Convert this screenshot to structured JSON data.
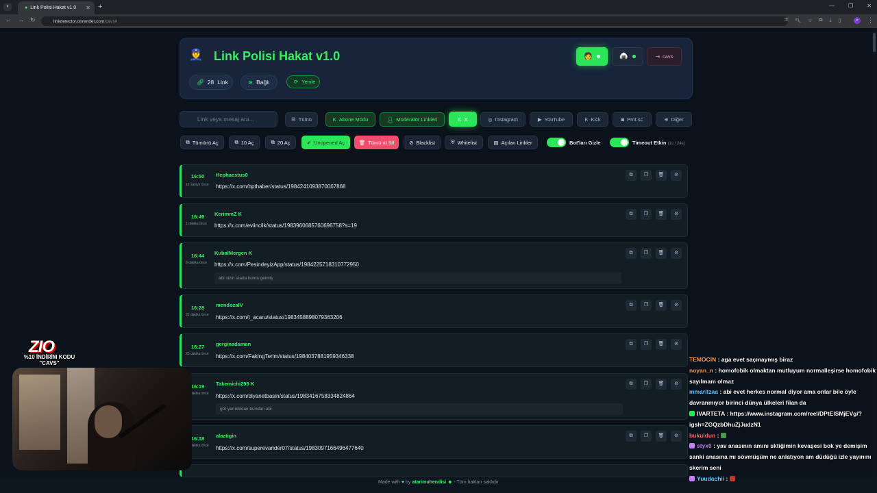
{
  "browser": {
    "tab_title": "Link Polisi Hakat v1.0",
    "tab_close": "✕",
    "new_tab": "+",
    "url_host": "linkdetector.onrender.com",
    "url_path": "/cavs#"
  },
  "header": {
    "title": "Link Polisi Hakat v1.0",
    "link_count": "28",
    "link_label": "Link",
    "connection_label": "Bağlı",
    "refresh_label": "Yenile",
    "logout_label": "cavs"
  },
  "filters": {
    "search_placeholder": "Link veya mesaj ara...",
    "all": "Tümü",
    "subscriber": "Abone Modu",
    "moderator": "Moderatör Linkleri",
    "x": "X",
    "instagram": "Instagram",
    "youtube": "YouTube",
    "kick": "Kick",
    "prnt": "Prnt.sc",
    "other": "Diğer"
  },
  "actions": {
    "open_all": "Tümünü Aç",
    "open_10": "10 Aç",
    "open_20": "20 Aç",
    "open_unopened": "Unopened Aç",
    "delete_all": "Tümünü Sil",
    "blacklist": "Blacklist",
    "whitelist": "Whitelist",
    "opened_links": "Açılan Linkler",
    "hide_bots": "Bot'ları Gizle",
    "timeout_active": "Timeout Etkin",
    "timeout_sub": "(1s / 24s)"
  },
  "links": [
    {
      "time": "16:50",
      "ago": "12 saniye önce",
      "user": "Hephaestus0",
      "url": "https://x.com/bpthaber/status/1984241093870067868",
      "msg": ""
    },
    {
      "time": "16:49",
      "ago": "1 dakika önce",
      "user": "KerimmZ",
      "url": "https://x.com/eviincilk/status/1983960685760696758?s=19",
      "msg": ""
    },
    {
      "time": "16:44",
      "ago": "6 dakika önce",
      "user": "KubalMergen",
      "url": "https://x.com/PesindeyizApp/status/1984225718310772950",
      "msg": "abi sizin stada kuma gelmiş"
    },
    {
      "time": "16:28",
      "ago": "22 dakika önce",
      "user": "mendozaIV",
      "url": "https://x.com/t_acaru/status/1983458898079363206",
      "msg": ""
    },
    {
      "time": "16:27",
      "ago": "23 dakika önce",
      "user": "gerginadaman",
      "url": "https://x.com/FakingTerim/status/1984037881959346338",
      "msg": ""
    },
    {
      "time": "16:19",
      "ago": "31 dakika önce",
      "user": "Takemichi299",
      "url": "https://x.com/diyanetbasin/status/1983416758334824864",
      "msg": "göt yanıklıklan bundan abi"
    },
    {
      "time": "16:18",
      "ago": "32 dakika önce",
      "user": "alaztigin",
      "url": "https://x.com/superevarider07/status/1983097166496477640",
      "msg": ""
    }
  ],
  "footer": {
    "made_with": "Made with",
    "by": "by",
    "author": "atarimuhendisi",
    "rights": "- Tüm hakları saklıdır"
  },
  "promo": {
    "logo": "ZIO",
    "text": "%10 İNDİRİM KODU \"CAVS\""
  },
  "chat": [
    {
      "user": "TEMOCIN",
      "color": "#ff9d4d",
      "text": ": aga evet saçmaymış biraz"
    },
    {
      "user": "noyan_n",
      "color": "#ff9d4d",
      "text": ": homofobik olmaktan mutluyum normalleşirse homofobik sayılmam olmaz"
    },
    {
      "user": "mmaritzaa",
      "color": "#6ec9ff",
      "text": ": abi evet herkes normal diyor ama onlar bile öyle davranmıyor birinci dünya ülkeleri filan da"
    },
    {
      "user": "IVARTETA",
      "color": "#ffffff",
      "text": ": https://www.instagram.com/reel/DPtEISMjEVg/?igsh=ZGQzbDhuZjJudzN1"
    },
    {
      "user": "bukuldun",
      "color": "#ff6b6b",
      "text": ":"
    },
    {
      "user": "styx0",
      "color": "#c77dff",
      "text": ": yav anasının amını sktiğimin kevaşesi bok ye demişim sanki anasına mı sövmüşüm ne anlatıyon am düdüğü izle yayınını skerim seni"
    },
    {
      "user": "Yuudachii",
      "color": "#6ec9ff",
      "text": ":"
    }
  ]
}
